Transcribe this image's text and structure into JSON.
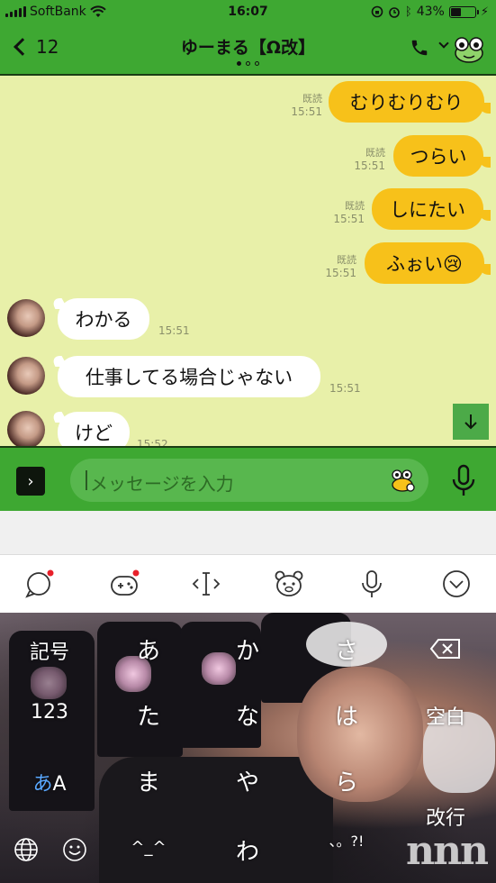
{
  "status_bar": {
    "carrier": "SoftBank",
    "time": "16:07",
    "battery_percent": "43%",
    "battery_level": 0.43,
    "icons": [
      "signal-icon",
      "wifi-icon",
      "rotation-lock-icon",
      "alarm-icon",
      "bluetooth-icon",
      "battery-icon",
      "charging-icon"
    ]
  },
  "header": {
    "back_count": "12",
    "title": "ゆーまる【Ω改】",
    "page_indicator": {
      "count": 3,
      "active": 1
    },
    "icons": [
      "back-chevron-icon",
      "phone-icon",
      "chevron-down-icon",
      "frog-mascot-icon"
    ]
  },
  "messages": [
    {
      "side": "out",
      "text": "むりむりむり",
      "read": "既読",
      "time": "15:51"
    },
    {
      "side": "out",
      "text": "つらい",
      "read": "既読",
      "time": "15:51"
    },
    {
      "side": "out",
      "text": "しにたい",
      "read": "既読",
      "time": "15:51"
    },
    {
      "side": "out",
      "text": "ふぉい😢",
      "read": "既読",
      "time": "15:51"
    },
    {
      "side": "in",
      "text": "わかる",
      "time": "15:51"
    },
    {
      "side": "in",
      "text": "仕事してる場合じゃない",
      "time": "15:51"
    },
    {
      "side": "in",
      "text": "けど",
      "time": "15:52"
    }
  ],
  "input": {
    "placeholder": "メッセージを入力"
  },
  "toolbar": {
    "icons": [
      "chat-bubble-icon",
      "emoji-game-icon",
      "cursor-move-icon",
      "bear-face-icon",
      "microphone-icon",
      "chevron-down-circle-icon"
    ]
  },
  "keyboard": {
    "rows": [
      [
        "記号",
        "あ",
        "か",
        "さ",
        "⌫"
      ],
      [
        "123",
        "た",
        "な",
        "は",
        "空白"
      ],
      [
        "あA",
        "ま",
        "や",
        "ら",
        "改行"
      ],
      [
        "🌐",
        "☺",
        "^_^",
        "わ",
        "?。、!"
      ]
    ],
    "punct_key": "、。?!",
    "caret_face": "^_^",
    "watermark": "nnn"
  },
  "colors": {
    "header_green": "#3ea832",
    "chat_background": "#e8f0a9",
    "outgoing_bubble": "#f7c11a",
    "incoming_bubble": "#ffffff",
    "notification_dot": "#e8202a"
  }
}
